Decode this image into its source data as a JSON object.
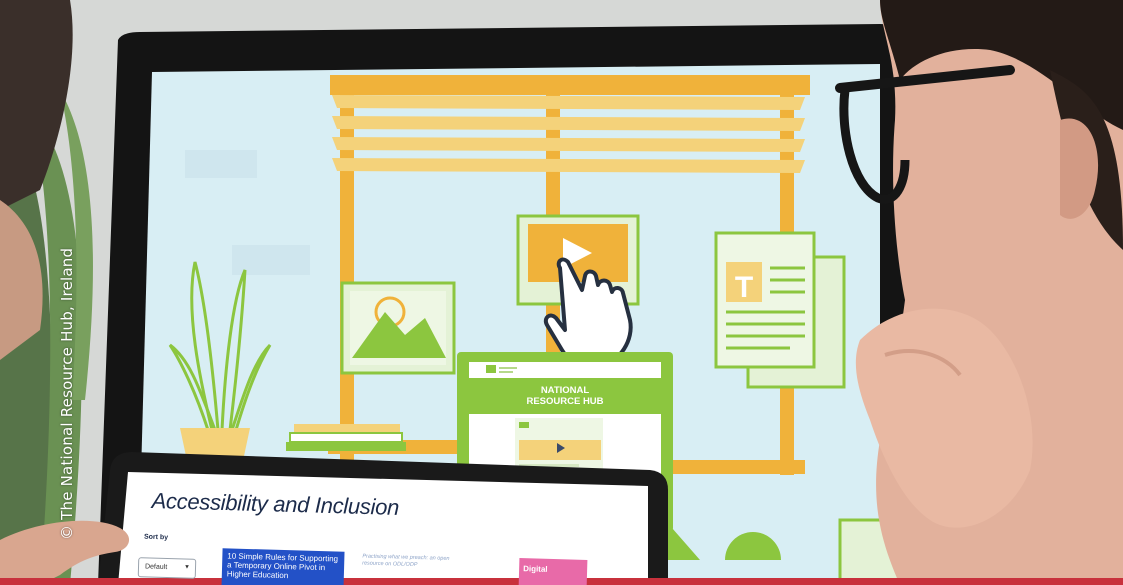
{
  "credit": {
    "text": "© The National Resource Hub, Ireland"
  },
  "monitor": {
    "hub_title_line1": "NATIONAL",
    "hub_title_line2": "RESOURCE HUB",
    "doc_icon_letter": "T"
  },
  "laptop": {
    "page_title": "Accessibility and Inclusion",
    "sort_label": "Sort by",
    "sort_value": "Default",
    "cards": [
      {
        "title": "10 Simple Rules for Supporting a Temporary Online Pivot in Higher Education"
      },
      {
        "title": "Practising what we preach: an open resource on ODL/ODP"
      },
      {
        "title": "Digital"
      }
    ]
  },
  "colors": {
    "screen_bg": "#d8eef4",
    "accent_orange": "#f0b23a",
    "accent_yellow": "#f4d27a",
    "accent_green": "#8cc63f",
    "brand_navy": "#1c2b4a",
    "bottom_bar": "#c8313c"
  }
}
